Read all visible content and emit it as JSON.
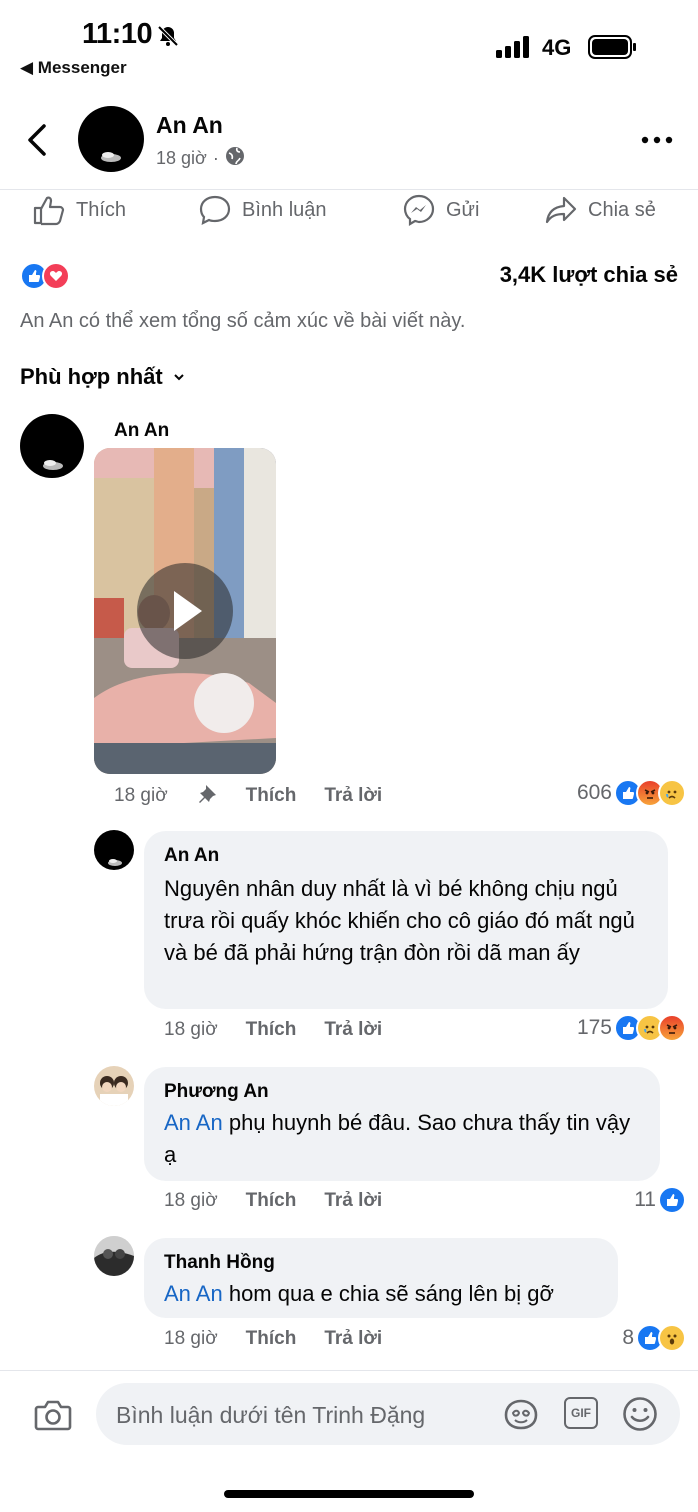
{
  "status_bar": {
    "time": "11:10",
    "back_app": "Messenger",
    "network": "4G"
  },
  "header": {
    "name": "An An",
    "time": "18 giờ",
    "separator": "·"
  },
  "actions": {
    "like": "Thích",
    "comment": "Bình luận",
    "send": "Gửi",
    "share": "Chia sẻ"
  },
  "post_stats": {
    "shares": "3,4K lượt chia sẻ",
    "note": "An An có thể xem tổng số cảm xúc về bài viết này."
  },
  "sort": {
    "label": "Phù hợp nhất"
  },
  "comments": [
    {
      "name": "An An",
      "time": "18 giờ",
      "like": "Thích",
      "reply": "Trả lời",
      "count": "606",
      "reactions": [
        "like",
        "angry",
        "sad"
      ]
    },
    {
      "name": "An An",
      "text": "Nguyên nhân duy nhất là vì bé không chịu ngủ trưa rồi quấy khóc khiến cho cô giáo đó mất ngủ và bé đã phải hứng trận đòn rồi dã man ấy",
      "time": "18 giờ",
      "like": "Thích",
      "reply": "Trả lời",
      "count": "175",
      "reactions": [
        "like",
        "sad",
        "angry"
      ]
    },
    {
      "name": "Phương An",
      "mention": "An An",
      "text": " phụ huynh bé đâu. Sao chưa thấy tin vậy ạ",
      "time": "18 giờ",
      "like": "Thích",
      "reply": "Trả lời",
      "count": "11",
      "reactions": [
        "like"
      ]
    },
    {
      "name": "Thanh Hồng",
      "mention": "An An",
      "text": " hom qua e chia sẽ sáng lên bị gỡ",
      "time": "18 giờ",
      "like": "Thích",
      "reply": "Trả lời",
      "count": "8",
      "reactions": [
        "like",
        "wow"
      ]
    }
  ],
  "composer": {
    "placeholder": "Bình luận dưới tên Trinh Đặng",
    "gif": "GIF"
  },
  "colors": {
    "accent": "#1877f2",
    "mention": "#1766c5",
    "bubble": "#f0f2f5",
    "muted": "#65676b"
  }
}
